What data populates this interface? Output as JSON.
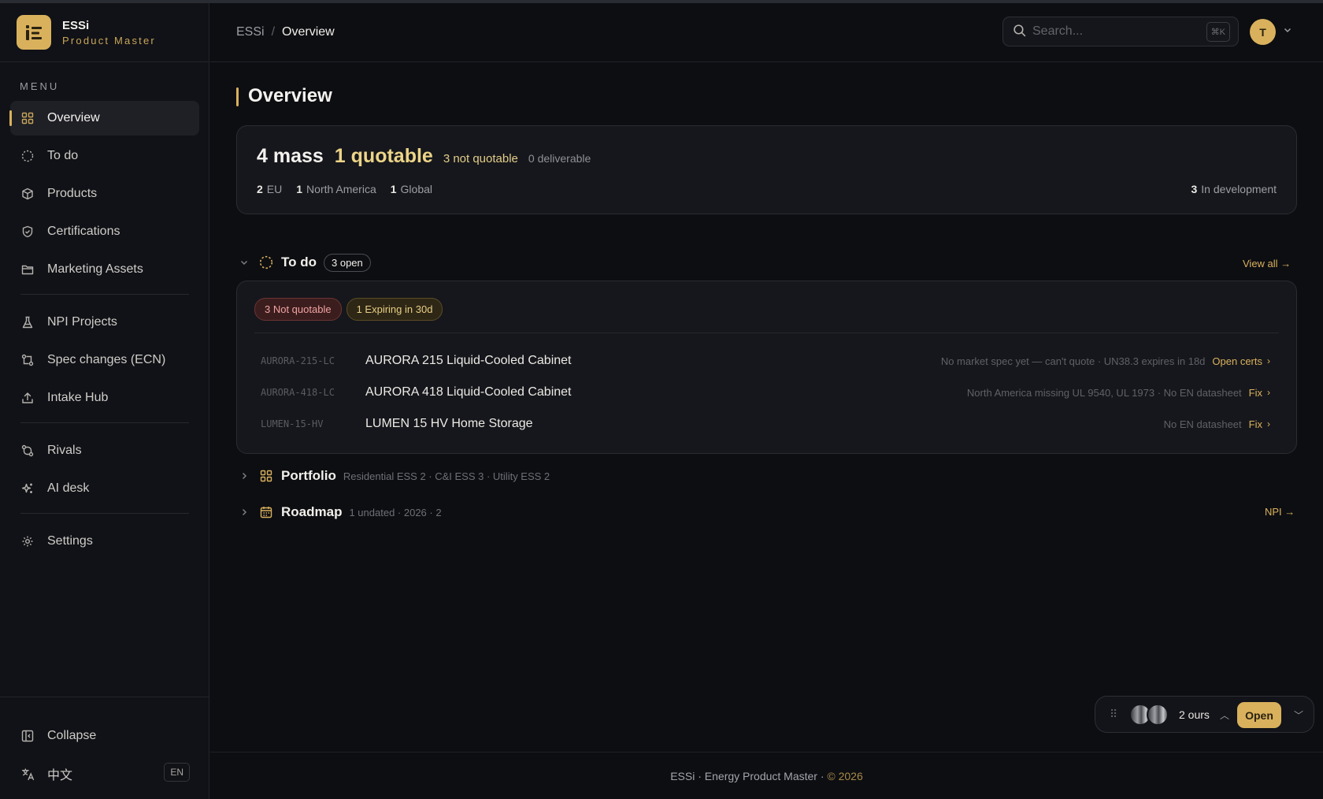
{
  "brand": {
    "title": "ESSi",
    "subtitle": "Product Master"
  },
  "sidebar": {
    "menu_label": "MENU",
    "items": [
      {
        "label": "Overview",
        "icon": "grid-icon",
        "active": true
      },
      {
        "label": "To do",
        "icon": "dashed-circle-icon"
      },
      {
        "label": "Products",
        "icon": "box-icon"
      },
      {
        "label": "Certifications",
        "icon": "shield-check-icon"
      },
      {
        "label": "Marketing Assets",
        "icon": "folder-icon"
      },
      {
        "label": "NPI Projects",
        "icon": "flask-icon"
      },
      {
        "label": "Spec changes (ECN)",
        "icon": "git-compare-icon"
      },
      {
        "label": "Intake Hub",
        "icon": "upload-icon"
      },
      {
        "label": "Rivals",
        "icon": "swap-icon"
      },
      {
        "label": "AI desk",
        "icon": "sparkles-icon"
      },
      {
        "label": "Settings",
        "icon": "gear-icon"
      }
    ],
    "collapse_label": "Collapse",
    "language_label": "中文",
    "language_badge": "EN"
  },
  "header": {
    "breadcrumb_root": "ESSi",
    "breadcrumb_sep": "/",
    "breadcrumb_current": "Overview",
    "search_placeholder": "Search...",
    "search_shortcut": "⌘K",
    "avatar_initial": "T"
  },
  "main": {
    "title": "Overview",
    "summary": {
      "mass": "4 mass",
      "quotable": "1 quotable",
      "not_quotable": "3 not quotable",
      "deliverable": "0 deliverable",
      "regions": [
        {
          "count": "2",
          "label": "EU"
        },
        {
          "count": "1",
          "label": "North America"
        },
        {
          "count": "1",
          "label": "Global"
        }
      ],
      "in_dev_count": "3",
      "in_dev_label": "In development"
    },
    "todo": {
      "title": "To do",
      "open_badge": "3 open",
      "view_all": "View all",
      "tags": [
        "3 Not quotable",
        "1 Expiring in 30d"
      ],
      "rows": [
        {
          "sku": "AURORA-215-LC",
          "name": "AURORA 215 Liquid-Cooled Cabinet",
          "issue": "No market spec yet — can't quote · UN38.3 expires in 18d",
          "action": "Open certs"
        },
        {
          "sku": "AURORA-418-LC",
          "name": "AURORA 418 Liquid-Cooled Cabinet",
          "issue": "North America missing UL 9540, UL 1973 · No EN datasheet",
          "action": "Fix"
        },
        {
          "sku": "LUMEN-15-HV",
          "name": "LUMEN 15 HV Home Storage",
          "issue": "No EN datasheet",
          "action": "Fix"
        }
      ]
    },
    "portfolio": {
      "title": "Portfolio",
      "meta": "Residential ESS 2 · C&I ESS 3 · Utility ESS 2"
    },
    "roadmap": {
      "title": "Roadmap",
      "meta": "1 undated · 2026 · 2",
      "link": "NPI"
    }
  },
  "footer": {
    "text": "ESSi · Energy Product Master · ",
    "year": "© 2026"
  },
  "widget": {
    "count": "2 ours",
    "open_label": "Open"
  },
  "colors": {
    "accent": "#d9b15d",
    "background": "#0d0e12",
    "danger_tag": "#3b1d1e"
  }
}
